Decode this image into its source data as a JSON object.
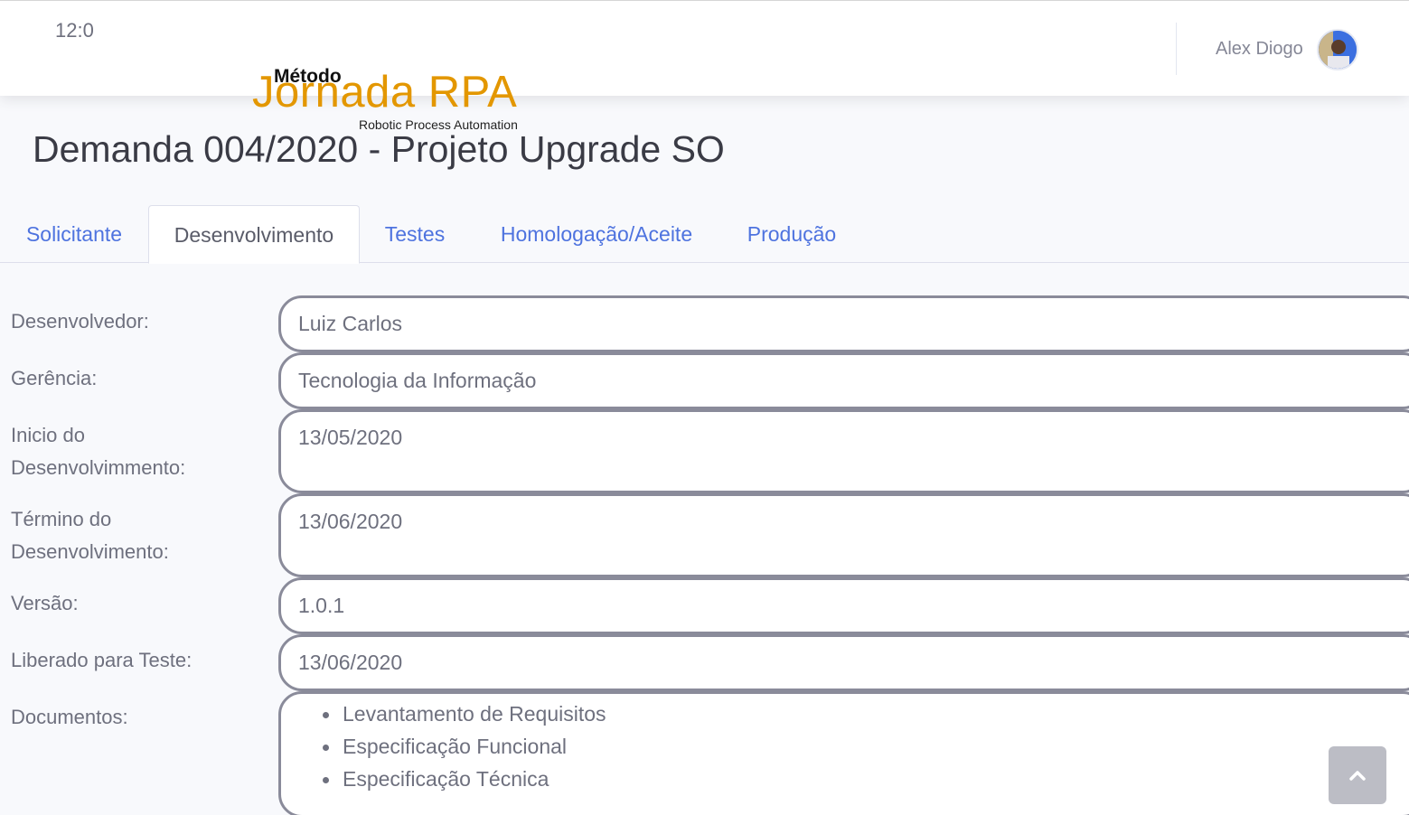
{
  "topbar": {
    "clock": "12:0",
    "user_name": "Alex Diogo"
  },
  "logo": {
    "top_word": "Método",
    "main_word": "Jornada RPA",
    "subtitle": "Robotic Process Automation",
    "colors": {
      "main": "#e39700"
    }
  },
  "page": {
    "title": "Demanda 004/2020 - Projeto Upgrade SO"
  },
  "tabs": [
    {
      "label": "Solicitante",
      "active": false
    },
    {
      "label": "Desenvolvimento",
      "active": true
    },
    {
      "label": "Testes",
      "active": false
    },
    {
      "label": "Homologação/Aceite",
      "active": false
    },
    {
      "label": "Produção",
      "active": false
    }
  ],
  "form": {
    "developer": {
      "label": "Desenvolvedor:",
      "value": "Luiz Carlos"
    },
    "management": {
      "label": "Gerência:",
      "value": "Tecnologia da Informação"
    },
    "dev_start": {
      "label_line1": "Inicio do",
      "label_line2": "Desenvolvimmento:",
      "value": "13/05/2020"
    },
    "dev_end": {
      "label_line1": "Término do",
      "label_line2": "Desenvolvimento:",
      "value": "13/06/2020"
    },
    "version": {
      "label": "Versão:",
      "value": "1.0.1"
    },
    "released_for_test": {
      "label": "Liberado para Teste:",
      "value": "13/06/2020"
    },
    "documents": {
      "label": "Documentos:",
      "items": [
        "Levantamento de Requisitos",
        "Especificação Funcional",
        "Especificação Técnica"
      ]
    }
  },
  "icons": {
    "scroll_top": "chevron-up-icon",
    "avatar": "user-avatar"
  },
  "colors": {
    "link": "#4e73df",
    "text": "#5a5c69",
    "field_border": "#8a8b9a"
  }
}
